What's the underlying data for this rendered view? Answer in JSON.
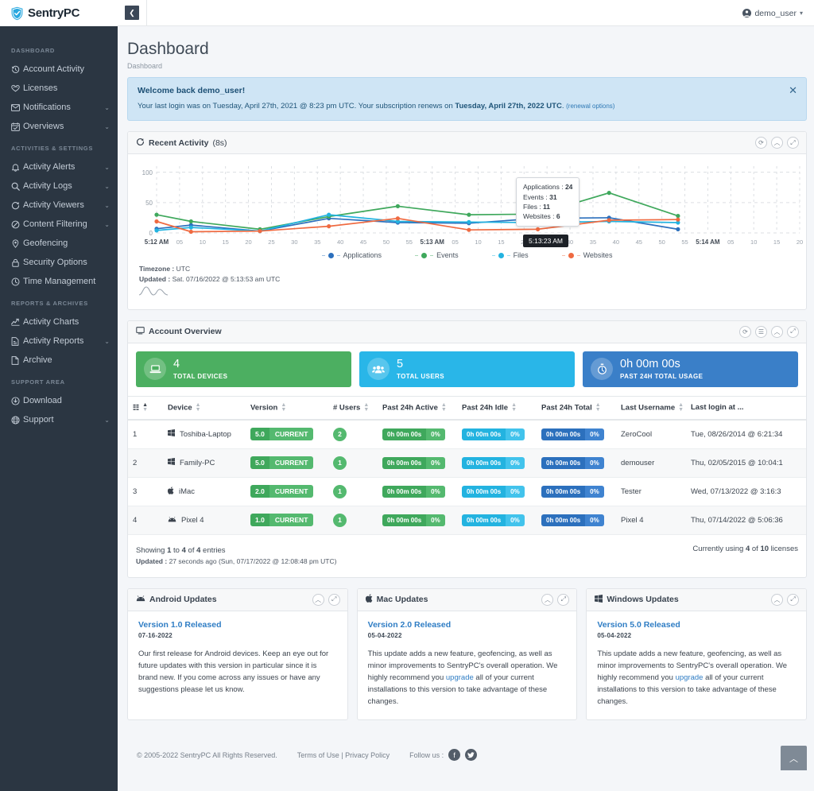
{
  "brand": {
    "name": "SentryPC",
    "logo_icon": "shield-check-icon"
  },
  "topbar": {
    "collapse_icon": "chevron-left-icon",
    "user_icon": "user-circle-icon",
    "username": "demo_user",
    "caret_icon": "chevron-down-icon"
  },
  "page": {
    "title": "Dashboard",
    "breadcrumb": "Dashboard"
  },
  "sidebar": {
    "sections": [
      {
        "label": "DASHBOARD",
        "items": [
          {
            "label": "Account Activity",
            "icon": "history-icon",
            "caret": false
          },
          {
            "label": "Licenses",
            "icon": "ribbon-icon",
            "caret": false
          },
          {
            "label": "Notifications",
            "icon": "envelope-icon",
            "caret": true
          },
          {
            "label": "Overviews",
            "icon": "calendar-check-icon",
            "caret": true
          }
        ]
      },
      {
        "label": "ACTIVITIES & SETTINGS",
        "items": [
          {
            "label": "Activity Alerts",
            "icon": "bell-icon",
            "caret": true
          },
          {
            "label": "Activity Logs",
            "icon": "search-icon",
            "caret": true
          },
          {
            "label": "Activity Viewers",
            "icon": "refresh-icon",
            "caret": true
          },
          {
            "label": "Content Filtering",
            "icon": "ban-icon",
            "caret": true
          },
          {
            "label": "Geofencing",
            "icon": "map-pin-icon",
            "caret": false
          },
          {
            "label": "Security Options",
            "icon": "lock-icon",
            "caret": false
          },
          {
            "label": "Time Management",
            "icon": "clock-icon",
            "caret": false
          }
        ]
      },
      {
        "label": "REPORTS & ARCHIVES",
        "items": [
          {
            "label": "Activity Charts",
            "icon": "chart-line-icon",
            "caret": false
          },
          {
            "label": "Activity Reports",
            "icon": "file-report-icon",
            "caret": true
          },
          {
            "label": "Archive",
            "icon": "archive-icon",
            "caret": false
          }
        ]
      },
      {
        "label": "SUPPORT AREA",
        "items": [
          {
            "label": "Download",
            "icon": "download-icon",
            "caret": false
          },
          {
            "label": "Support",
            "icon": "globe-icon",
            "caret": true
          }
        ]
      }
    ]
  },
  "alert": {
    "title": "Welcome back demo_user!",
    "text_1": "Your last login was on Tuesday, April 27th, 2021 @ 8:23 pm UTC.  Your subscription renews on ",
    "renew_date": "Tuesday, April 27th, 2022 UTC",
    "text_2": ".",
    "link": "(renewal options)",
    "close_icon": "close-icon"
  },
  "recent_activity": {
    "icon": "refresh-icon",
    "title": "Recent Activity",
    "interval": "(8s)",
    "tools": [
      "refresh-icon",
      "collapse-icon",
      "expand-icon"
    ],
    "tooltip": {
      "applications_label": "Applications :",
      "applications_value": "24",
      "events_label": "Events :",
      "events_value": "31",
      "files_label": "Files :",
      "files_value": "11",
      "websites_label": "Websites :",
      "websites_value": "6",
      "x_label": "5:13:23 AM"
    },
    "timezone_label": "Timezone :",
    "timezone_value": "UTC",
    "updated_label": "Updated :",
    "updated_value": "Sat. 07/16/2022 @ 5:13:53 am UTC"
  },
  "chart_data": {
    "type": "line",
    "title": "Recent Activity",
    "xlabel": "",
    "ylabel": "",
    "ylim": [
      0,
      110
    ],
    "yticks": [
      0,
      50,
      100
    ],
    "grid": true,
    "legend_position": "bottom",
    "xtick_labels": [
      "5:12 AM",
      "05",
      "10",
      "15",
      "20",
      "25",
      "30",
      "35",
      "40",
      "45",
      "50",
      "55",
      "5:13 AM",
      "05",
      "10",
      "15",
      "20",
      "25",
      "30",
      "35",
      "40",
      "45",
      "50",
      "55",
      "5:14 AM",
      "05",
      "10",
      "15",
      "20"
    ],
    "x_times": [
      "5:12:00",
      "5:12:07",
      "5:12:22",
      "5:12:37",
      "5:12:52",
      "5:13:08",
      "5:13:23",
      "5:13:38",
      "5:13:53"
    ],
    "colors": {
      "Applications": "#2c70bd",
      "Events": "#3fa85c",
      "Files": "#23b3e0",
      "Websites": "#ef6a41"
    },
    "series": [
      {
        "name": "Applications",
        "values": [
          7,
          13,
          3,
          24,
          17,
          16,
          24,
          25,
          6
        ]
      },
      {
        "name": "Events",
        "values": [
          30,
          19,
          6,
          27,
          44,
          30,
          31,
          66,
          28
        ]
      },
      {
        "name": "Files",
        "values": [
          4,
          9,
          3,
          30,
          19,
          18,
          17,
          19,
          17
        ]
      },
      {
        "name": "Websites",
        "values": [
          19,
          2,
          3,
          11,
          24,
          5,
          6,
          21,
          22
        ]
      }
    ]
  },
  "account_overview": {
    "icon": "monitor-icon",
    "title": "Account Overview",
    "tools": [
      "refresh-icon",
      "list-icon",
      "collapse-icon",
      "expand-icon"
    ],
    "stats": [
      {
        "value": "4",
        "label": "TOTAL DEVICES",
        "icon": "laptop-icon",
        "color": "#4caf61"
      },
      {
        "value": "5",
        "label": "TOTAL USERS",
        "icon": "users-icon",
        "color": "#29b6e8"
      },
      {
        "value": "0h 00m 00s",
        "label": "PAST 24h TOTAL USAGE",
        "icon": "stopwatch-icon",
        "color": "#3a7fc8"
      }
    ],
    "columns": [
      "",
      "Device",
      "Version",
      "# Users",
      "Past 24h Active",
      "Past 24h Idle",
      "Past 24h Total",
      "Last Username",
      "Last login at ..."
    ],
    "rows": [
      {
        "num": "1",
        "device": "Toshiba-Laptop",
        "device_icon": "windows-icon",
        "version": "5.0",
        "version_state": "CURRENT",
        "users": "2",
        "active": "0h 00m 00s",
        "active_pct": "0%",
        "idle": "0h 00m 00s",
        "idle_pct": "0%",
        "total": "0h 00m 00s",
        "total_pct": "0%",
        "username": "ZeroCool",
        "last_login": "Tue, 08/26/2014 @ 6:21:34"
      },
      {
        "num": "2",
        "device": "Family-PC",
        "device_icon": "windows-icon",
        "version": "5.0",
        "version_state": "CURRENT",
        "users": "1",
        "active": "0h 00m 00s",
        "active_pct": "0%",
        "idle": "0h 00m 00s",
        "idle_pct": "0%",
        "total": "0h 00m 00s",
        "total_pct": "0%",
        "username": "demouser",
        "last_login": "Thu, 02/05/2015 @ 10:04:1"
      },
      {
        "num": "3",
        "device": "iMac",
        "device_icon": "apple-icon",
        "version": "2.0",
        "version_state": "CURRENT",
        "users": "1",
        "active": "0h 00m 00s",
        "active_pct": "0%",
        "idle": "0h 00m 00s",
        "idle_pct": "0%",
        "total": "0h 00m 00s",
        "total_pct": "0%",
        "username": "Tester",
        "last_login": "Wed, 07/13/2022 @ 3:16:3"
      },
      {
        "num": "4",
        "device": "Pixel 4",
        "device_icon": "android-icon",
        "version": "1.0",
        "version_state": "CURRENT",
        "users": "1",
        "active": "0h 00m 00s",
        "active_pct": "0%",
        "idle": "0h 00m 00s",
        "idle_pct": "0%",
        "total": "0h 00m 00s",
        "total_pct": "0%",
        "username": "Pixel 4",
        "last_login": "Thu, 07/14/2022 @ 5:06:36"
      }
    ],
    "showing_prefix": "Showing ",
    "showing_from": "1",
    "showing_mid": " to ",
    "showing_to": "4",
    "showing_of": " of ",
    "showing_total": "4",
    "showing_suffix": " entries",
    "updated_label": "Updated :",
    "updated_value": "27 seconds ago (Sun, 07/17/2022 @ 12:08:48 pm UTC)",
    "licenses_prefix": "Currently using ",
    "licenses_used": "4",
    "licenses_mid": " of ",
    "licenses_total": "10",
    "licenses_suffix": " licenses"
  },
  "updates": [
    {
      "icon": "android-icon",
      "title": "Android Updates",
      "tools": [
        "collapse-icon",
        "expand-icon"
      ],
      "version": "Version 1.0 Released",
      "date": "07-16-2022",
      "body_1": "Our first release for Android devices.  Keep an eye out for future updates with this version in particular since it is brand new.  If you come across any issues or have any suggestions please let us know.",
      "link": "",
      "body_2": ""
    },
    {
      "icon": "apple-icon",
      "title": "Mac Updates",
      "tools": [
        "collapse-icon",
        "expand-icon"
      ],
      "version": "Version 2.0 Released",
      "date": "05-04-2022",
      "body_1": "This update adds a new feature, geofencing, as well as minor improvements to SentryPC's overall operation.  We highly recommend you ",
      "link": "upgrade",
      "body_2": " all of your current installations to this version to take advantage of these changes."
    },
    {
      "icon": "windows-icon",
      "title": "Windows Updates",
      "tools": [
        "collapse-icon",
        "expand-icon"
      ],
      "version": "Version 5.0 Released",
      "date": "05-04-2022",
      "body_1": "This update adds a new feature, geofencing, as well as minor improvements to SentryPC's overall operation.  We highly recommend you ",
      "link": "upgrade",
      "body_2": " all of your current installations to this version to take advantage of these changes."
    }
  ],
  "footer": {
    "copyright": "© 2005-2022 SentryPC All Rights Reserved.",
    "terms": "Terms of Use",
    "divider": "|",
    "privacy": "Privacy Policy",
    "follow_label": "Follow us :",
    "facebook_icon": "facebook-icon",
    "twitter_icon": "twitter-icon",
    "to_top_icon": "chevron-up-icon"
  }
}
